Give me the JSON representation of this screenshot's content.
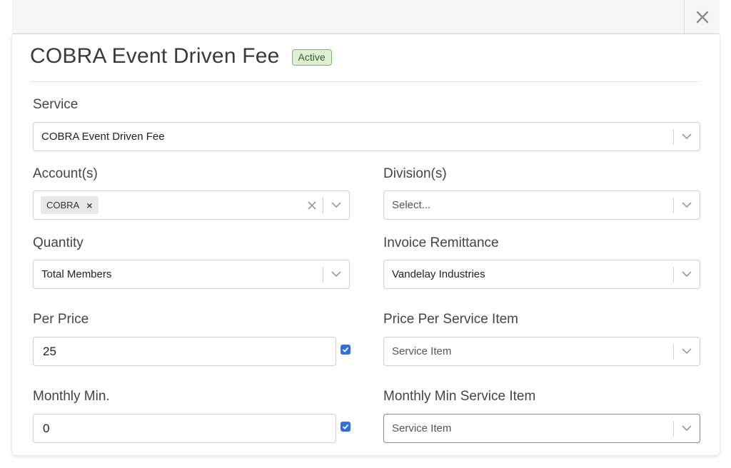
{
  "header": {
    "close_icon": "close-icon"
  },
  "panel": {
    "title": "COBRA Event Driven Fee",
    "status": "Active",
    "colors": {
      "status_bg": "#dff0d4",
      "status_border": "#7bb468",
      "checkbox": "#2f6fe0"
    }
  },
  "fields": {
    "service": {
      "label": "Service",
      "value": "COBRA Event Driven Fee"
    },
    "accounts": {
      "label": "Account(s)",
      "chips": [
        "COBRA"
      ]
    },
    "divisions": {
      "label": "Division(s)",
      "placeholder": "Select..."
    },
    "quantity": {
      "label": "Quantity",
      "value": "Total Members"
    },
    "invoice_remittance": {
      "label": "Invoice Remittance",
      "value": "Vandelay Industries"
    },
    "per_price": {
      "label": "Per Price",
      "value": "25",
      "checked": true
    },
    "price_per_service_item": {
      "label": "Price Per Service Item",
      "placeholder": "Service Item"
    },
    "monthly_min": {
      "label": "Monthly Min.",
      "value": "0",
      "checked": true
    },
    "monthly_min_service_item": {
      "label": "Monthly Min Service Item",
      "placeholder": "Service Item"
    }
  }
}
